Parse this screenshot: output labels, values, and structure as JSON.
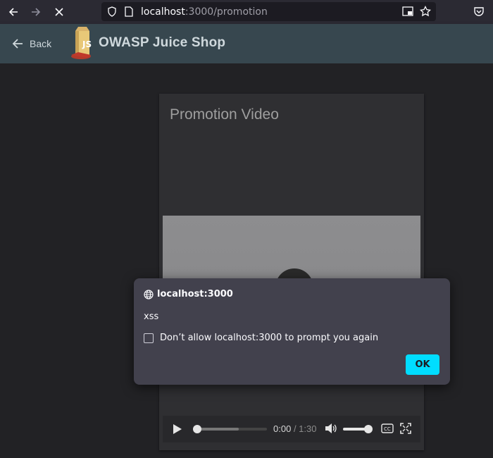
{
  "browser": {
    "url_host": "localhost",
    "url_path": ":3000/promotion"
  },
  "app": {
    "back_label": "Back",
    "shop_title": "OWASP Juice Shop"
  },
  "video_card": {
    "title": "Promotion Video",
    "current_time": "0:00",
    "duration": "/ 1:30",
    "progress_fraction": 0.0,
    "volume_fraction": 1.0
  },
  "dialog": {
    "origin": "localhost:3000",
    "message": "xss",
    "checkbox_label": "Don’t allow localhost:3000 to prompt you again",
    "checkbox_checked": false,
    "ok_label": "OK"
  }
}
